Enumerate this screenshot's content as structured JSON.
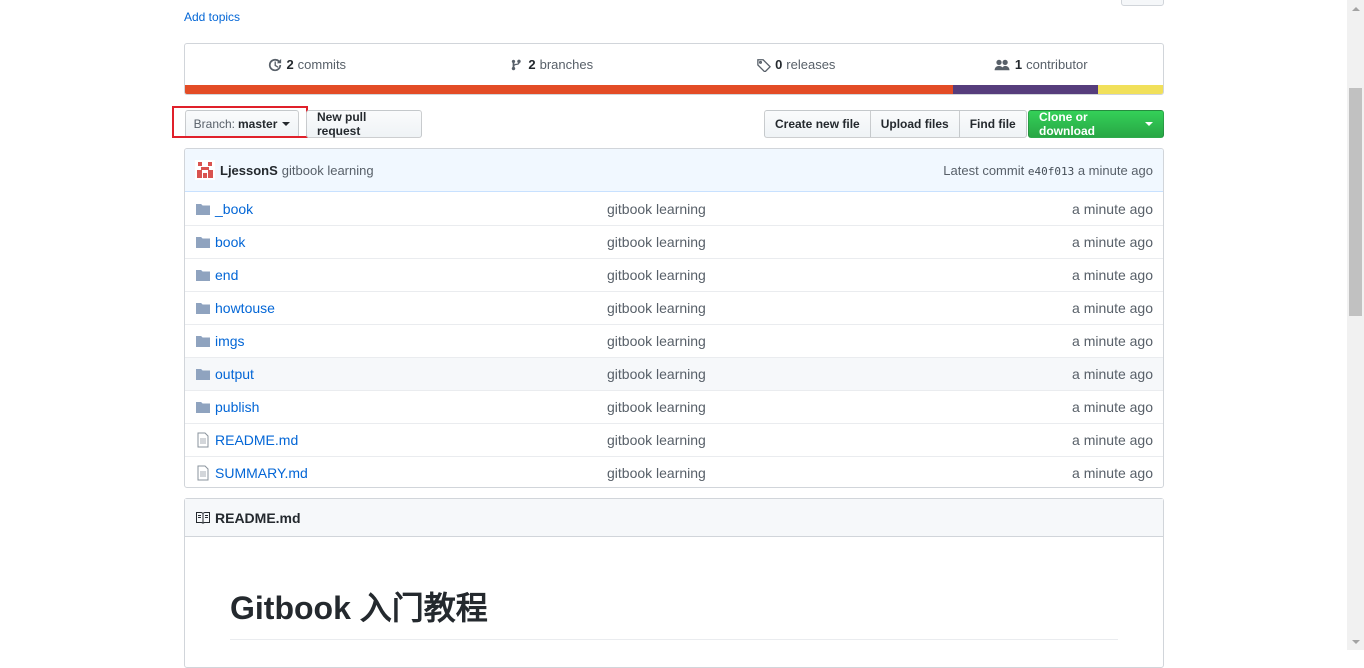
{
  "repo": {
    "add_topics": "Add topics"
  },
  "summary": {
    "commits_count": "2",
    "commits_label": "commits",
    "branches_count": "2",
    "branches_label": "branches",
    "releases_count": "0",
    "releases_label": "releases",
    "contributors_count": "1",
    "contributors_label": "contributor",
    "language_colors": [
      "#e34c26",
      "#563d7c",
      "#f1e05a"
    ],
    "language_shares": [
      0.785,
      0.149,
      0.066
    ]
  },
  "toolbar": {
    "branch_prefix": "Branch:",
    "branch_name": "master",
    "new_pr": "New pull request",
    "create_file": "Create new file",
    "upload_files": "Upload files",
    "find_file": "Find file",
    "clone": "Clone or download"
  },
  "commit": {
    "author": "LjessonS",
    "message": "gitbook learning",
    "latest_label": "Latest commit",
    "sha": "e40f013",
    "time": "a minute ago"
  },
  "files": [
    {
      "name": "_book",
      "type": "dir",
      "message": "gitbook learning",
      "age": "a minute ago"
    },
    {
      "name": "book",
      "type": "dir",
      "message": "gitbook learning",
      "age": "a minute ago"
    },
    {
      "name": "end",
      "type": "dir",
      "message": "gitbook learning",
      "age": "a minute ago"
    },
    {
      "name": "howtouse",
      "type": "dir",
      "message": "gitbook learning",
      "age": "a minute ago"
    },
    {
      "name": "imgs",
      "type": "dir",
      "message": "gitbook learning",
      "age": "a minute ago"
    },
    {
      "name": "output",
      "type": "dir",
      "message": "gitbook learning",
      "age": "a minute ago"
    },
    {
      "name": "publish",
      "type": "dir",
      "message": "gitbook learning",
      "age": "a minute ago"
    },
    {
      "name": "README.md",
      "type": "file",
      "message": "gitbook learning",
      "age": "a minute ago"
    },
    {
      "name": "SUMMARY.md",
      "type": "file",
      "message": "gitbook learning",
      "age": "a minute ago"
    }
  ],
  "readme": {
    "filename": "README.md",
    "title": "Gitbook 入门教程"
  }
}
